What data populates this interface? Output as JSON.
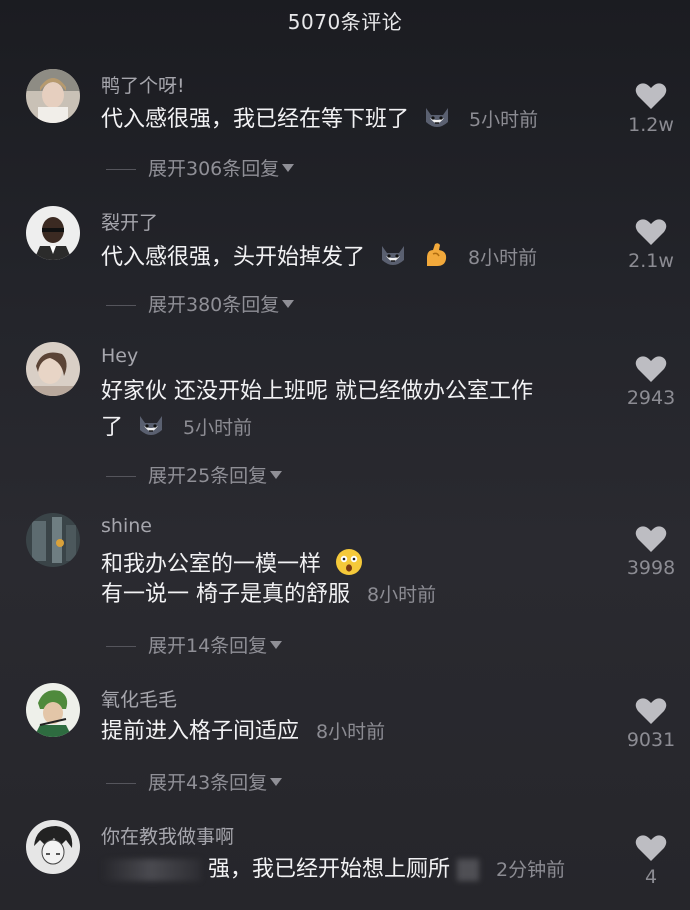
{
  "header": {
    "title": "5070条评论"
  },
  "comments": [
    {
      "username": "鸭了个呀!",
      "lines": [
        "代入感很强，我已经在等下班了"
      ],
      "time": "5小时前",
      "emoji": [
        "husky-emoji"
      ],
      "likes": "1.2w",
      "expand": "展开306条回复"
    },
    {
      "username": "裂开了",
      "lines": [
        "代入感很强，头开始掉发了"
      ],
      "time": "8小时前",
      "emoji": [
        "husky-emoji",
        "muscle-emoji"
      ],
      "likes": "2.1w",
      "expand": "展开380条回复"
    },
    {
      "username": "Hey",
      "lines": [
        "好家伙 还没开始上班呢 就已经做办公室工作",
        "了"
      ],
      "time": "5小时前",
      "emoji": [
        "husky-emoji"
      ],
      "likes": "2943",
      "expand": "展开25条回复"
    },
    {
      "username": "shine",
      "lines": [
        "和我办公室的一模一样",
        "有一说一 椅子是真的舒服"
      ],
      "time": "8小时前",
      "emoji": [
        "shocked-emoji"
      ],
      "likes": "3998",
      "expand": "展开14条回复"
    },
    {
      "username": "氧化毛毛",
      "lines": [
        "提前进入格子间适应"
      ],
      "time": "8小时前",
      "likes": "9031",
      "expand": "展开43条回复"
    },
    {
      "username": "你在教我做事啊",
      "lines": [
        "强，我已经开始想上厕所"
      ],
      "time": "2分钟前",
      "likes": "4"
    }
  ]
}
